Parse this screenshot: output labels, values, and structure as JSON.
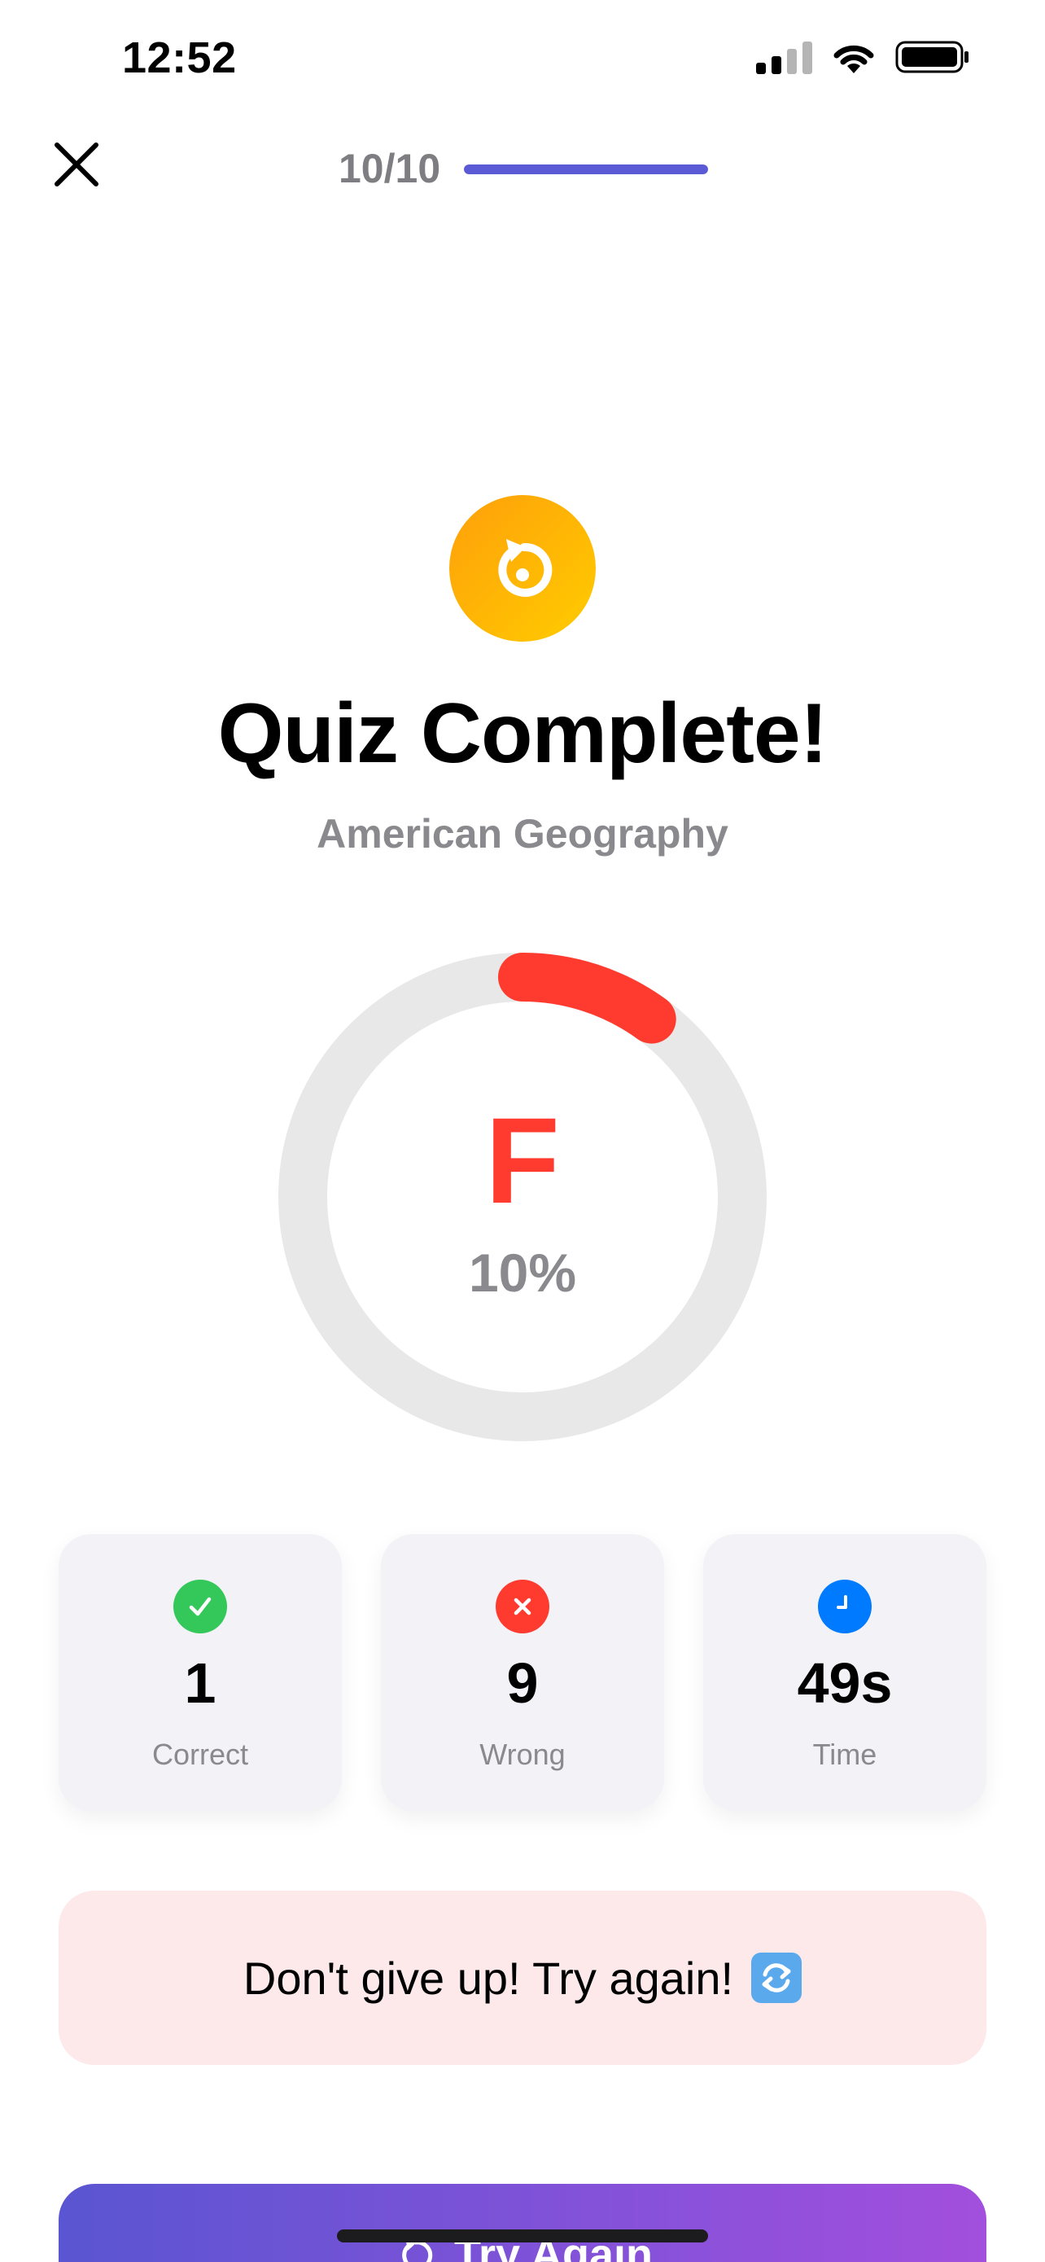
{
  "status_bar": {
    "time": "12:52"
  },
  "header": {
    "progress_text": "10/10",
    "progress_fraction": 1.0
  },
  "result": {
    "icon": "retry-arrow-icon",
    "title": "Quiz Complete!",
    "subtitle": "American Geography",
    "grade": "F",
    "percent_label": "10%",
    "score_fraction": 0.1
  },
  "stats": [
    {
      "icon": "check-icon",
      "value": "1",
      "label": "Correct",
      "color": "#34c759"
    },
    {
      "icon": "x-icon",
      "value": "9",
      "label": "Wrong",
      "color": "#ff3b30"
    },
    {
      "icon": "clock-icon",
      "value": "49s",
      "label": "Time",
      "color": "#007aff"
    }
  ],
  "message": {
    "text": "Don't give up! Try again!",
    "emoji_icon": "repeat-arrows-icon"
  },
  "actions": {
    "try_again_label": "Try Again"
  },
  "colors": {
    "accent": "#5a5ad6",
    "grade_fail": "#ff3b30",
    "ring_track": "#e8e8e8",
    "banner_bg": "#fde9ea"
  }
}
